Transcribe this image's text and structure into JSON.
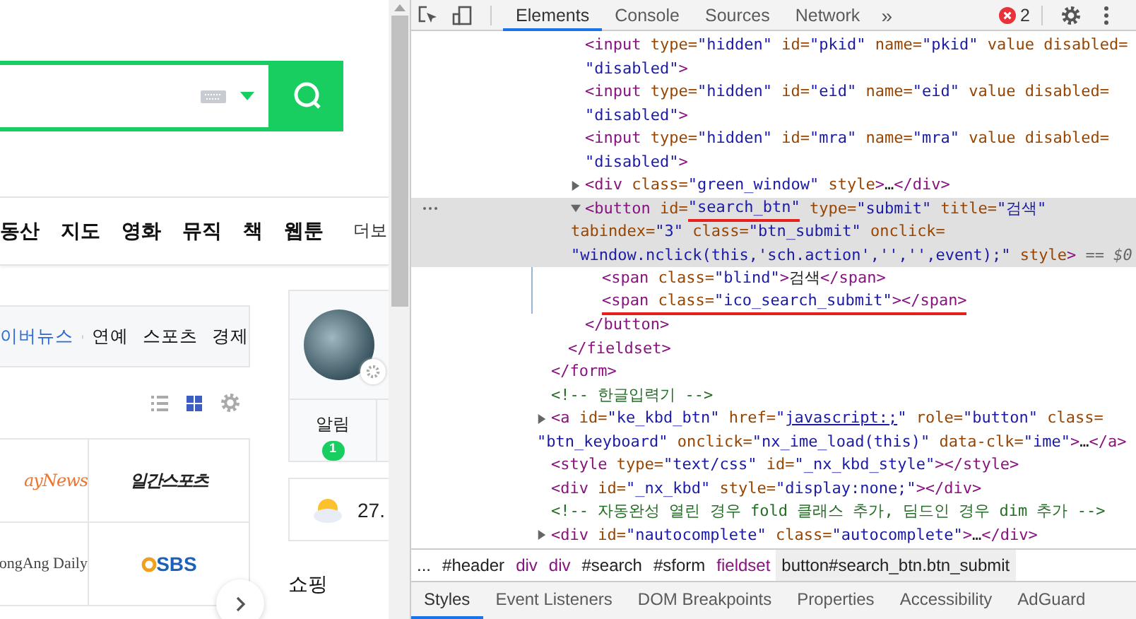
{
  "page": {
    "nav_items": [
      "동산",
      "지도",
      "영화",
      "뮤직",
      "책",
      "웹툰"
    ],
    "nav_more": "더보",
    "news_tabs": [
      {
        "label": "이버뉴스",
        "selected": true
      },
      {
        "label": "연예",
        "selected": false
      },
      {
        "label": "스포츠",
        "selected": false
      },
      {
        "label": "경제",
        "selected": false
      }
    ],
    "view_modes": [
      {
        "kind": "list",
        "selected": false
      },
      {
        "kind": "grid",
        "selected": true
      }
    ],
    "press": [
      {
        "label": "ayNews",
        "kind": "script"
      },
      {
        "label": "일간스포츠",
        "kind": "bold"
      },
      {
        "label": "ongAng Daily",
        "kind": "serif"
      },
      {
        "label": "SBS",
        "kind": "sbs"
      }
    ],
    "notification": {
      "label": "알림",
      "badge": "1"
    },
    "weather": {
      "temp": "27."
    },
    "shopping_title": "쇼핑"
  },
  "devtools": {
    "tabs": [
      {
        "label": "Elements",
        "selected": true
      },
      {
        "label": "Console",
        "selected": false
      },
      {
        "label": "Sources",
        "selected": false
      },
      {
        "label": "Network",
        "selected": false
      }
    ],
    "more_tabs": "»",
    "error_count": "2",
    "tree": [
      {
        "children": [
          {
            "children": [
              {
                "selected": false,
                "lines": [
                  [
                    {
                      "kind": "tag",
                      "text": "<input"
                    },
                    {
                      "kind": "attr",
                      "text": " type="
                    },
                    {
                      "kind": "value",
                      "text": "\"hidden\""
                    },
                    {
                      "kind": "attr",
                      "text": " id="
                    },
                    {
                      "kind": "value",
                      "text": "\"pkid\""
                    },
                    {
                      "kind": "attr",
                      "text": " name="
                    },
                    {
                      "kind": "value",
                      "text": "\"pkid\""
                    },
                    {
                      "kind": "attr",
                      "text": " value disabled="
                    }
                  ],
                  [
                    {
                      "kind": "value",
                      "text": "\"disabled\""
                    },
                    {
                      "kind": "tag",
                      "text": ">"
                    }
                  ]
                ]
              },
              {
                "selected": false,
                "lines": [
                  [
                    {
                      "kind": "tag",
                      "text": "<input"
                    },
                    {
                      "kind": "attr",
                      "text": " type="
                    },
                    {
                      "kind": "value",
                      "text": "\"hidden\""
                    },
                    {
                      "kind": "attr",
                      "text": " id="
                    },
                    {
                      "kind": "value",
                      "text": "\"eid\""
                    },
                    {
                      "kind": "attr",
                      "text": " name="
                    },
                    {
                      "kind": "value",
                      "text": "\"eid\""
                    },
                    {
                      "kind": "attr",
                      "text": " value disabled="
                    }
                  ],
                  [
                    {
                      "kind": "value",
                      "text": "\"disabled\""
                    },
                    {
                      "kind": "tag",
                      "text": ">"
                    }
                  ]
                ]
              },
              {
                "selected": false,
                "lines": [
                  [
                    {
                      "kind": "tag",
                      "text": "<input"
                    },
                    {
                      "kind": "attr",
                      "text": " type="
                    },
                    {
                      "kind": "value",
                      "text": "\"hidden\""
                    },
                    {
                      "kind": "attr",
                      "text": " id="
                    },
                    {
                      "kind": "value",
                      "text": "\"mra\""
                    },
                    {
                      "kind": "attr",
                      "text": " name="
                    },
                    {
                      "kind": "value",
                      "text": "\"mra\""
                    },
                    {
                      "kind": "attr",
                      "text": " value disabled="
                    }
                  ],
                  [
                    {
                      "kind": "value",
                      "text": "\"disabled\""
                    },
                    {
                      "kind": "tag",
                      "text": ">"
                    }
                  ]
                ]
              },
              {
                "selected": false,
                "expanded": false,
                "lines": [
                  [
                    {
                      "kind": "tag",
                      "text": "<div"
                    },
                    {
                      "kind": "attr",
                      "text": " class="
                    },
                    {
                      "kind": "value",
                      "text": "\"green_window\""
                    },
                    {
                      "kind": "attr",
                      "text": " style"
                    },
                    {
                      "kind": "tag",
                      "text": ">"
                    },
                    {
                      "kind": "text",
                      "text": "…"
                    },
                    {
                      "kind": "tag",
                      "text": "</div>"
                    }
                  ]
                ]
              },
              {
                "selected": true,
                "expanded": true,
                "lines": [
                  [
                    {
                      "kind": "tag",
                      "text": "<button"
                    },
                    {
                      "kind": "attr",
                      "text": " id="
                    },
                    {
                      "kind": "value",
                      "text": "\"search_btn\"",
                      "marked": true
                    },
                    {
                      "kind": "attr",
                      "text": " type="
                    },
                    {
                      "kind": "value",
                      "text": "\"submit\""
                    },
                    {
                      "kind": "attr",
                      "text": " title="
                    },
                    {
                      "kind": "value",
                      "text": "\"검색\""
                    }
                  ],
                  [
                    {
                      "kind": "attr",
                      "text": "tabindex="
                    },
                    {
                      "kind": "value",
                      "text": "\"3\""
                    },
                    {
                      "kind": "attr",
                      "text": " class="
                    },
                    {
                      "kind": "value",
                      "text": "\"btn_submit\""
                    },
                    {
                      "kind": "attr",
                      "text": " onclick="
                    }
                  ],
                  [
                    {
                      "kind": "value",
                      "text": "\"window.nclick(this,'sch.action','','',event);\""
                    },
                    {
                      "kind": "attr",
                      "text": " style"
                    },
                    {
                      "kind": "tag",
                      "text": ">"
                    },
                    {
                      "kind": "ref",
                      "text": " == $0"
                    }
                  ]
                ],
                "children": [
                  {
                    "selected": false,
                    "lines": [
                      [
                        {
                          "kind": "tag",
                          "text": "<span"
                        },
                        {
                          "kind": "attr",
                          "text": " class="
                        },
                        {
                          "kind": "value",
                          "text": "\"blind\""
                        },
                        {
                          "kind": "tag",
                          "text": ">"
                        },
                        {
                          "kind": "text",
                          "text": "검색"
                        },
                        {
                          "kind": "tag",
                          "text": "</span>"
                        }
                      ]
                    ]
                  },
                  {
                    "selected": false,
                    "lines": [
                      [
                        {
                          "kind": "tag",
                          "text": "<span",
                          "marked": true
                        },
                        {
                          "kind": "attr",
                          "text": " class=",
                          "marked": true
                        },
                        {
                          "kind": "value",
                          "text": "\"ico_search_submit\"",
                          "marked": true
                        },
                        {
                          "kind": "tag",
                          "text": "></span>",
                          "marked": true
                        }
                      ]
                    ]
                  }
                ],
                "close": "</button>"
              }
            ],
            "close": "</fieldset>"
          }
        ],
        "close": "</form>"
      },
      {
        "selected": false,
        "lines": [
          [
            {
              "kind": "comment",
              "text": "<!-- 한글입력기 -->"
            }
          ]
        ]
      },
      {
        "selected": false,
        "expanded": false,
        "lines": [
          [
            {
              "kind": "tag",
              "text": "<a"
            },
            {
              "kind": "attr",
              "text": " id="
            },
            {
              "kind": "value",
              "text": "\"ke_kbd_btn\""
            },
            {
              "kind": "attr",
              "text": " href="
            },
            {
              "kind": "value",
              "text": "\""
            },
            {
              "kind": "link",
              "text": "javascript:;"
            },
            {
              "kind": "value",
              "text": "\""
            },
            {
              "kind": "attr",
              "text": " role="
            },
            {
              "kind": "value",
              "text": "\"button\""
            },
            {
              "kind": "attr",
              "text": " class="
            }
          ],
          [
            {
              "kind": "value",
              "text": "\"btn_keyboard\""
            },
            {
              "kind": "attr",
              "text": " onclick="
            },
            {
              "kind": "value",
              "text": "\"nx_ime_load(this)\""
            },
            {
              "kind": "attr",
              "text": " data-clk="
            },
            {
              "kind": "value",
              "text": "\"ime\""
            },
            {
              "kind": "tag",
              "text": ">"
            },
            {
              "kind": "text",
              "text": "…"
            },
            {
              "kind": "tag",
              "text": "</a>"
            }
          ]
        ]
      },
      {
        "selected": false,
        "lines": [
          [
            {
              "kind": "tag",
              "text": "<style"
            },
            {
              "kind": "attr",
              "text": " type="
            },
            {
              "kind": "value",
              "text": "\"text/css\""
            },
            {
              "kind": "attr",
              "text": " id="
            },
            {
              "kind": "value",
              "text": "\"_nx_kbd_style\""
            },
            {
              "kind": "tag",
              "text": "></style>"
            }
          ]
        ]
      },
      {
        "selected": false,
        "lines": [
          [
            {
              "kind": "tag",
              "text": "<div"
            },
            {
              "kind": "attr",
              "text": " id="
            },
            {
              "kind": "value",
              "text": "\"_nx_kbd\""
            },
            {
              "kind": "attr",
              "text": " style="
            },
            {
              "kind": "value",
              "text": "\"display:none;\""
            },
            {
              "kind": "tag",
              "text": "></div>"
            }
          ]
        ]
      },
      {
        "selected": false,
        "lines": [
          [
            {
              "kind": "comment",
              "text": "<!-- 자동완성 열린 경우 fold 클래스 추가, 딤드인 경우 dim 추가 -->"
            }
          ]
        ]
      },
      {
        "selected": false,
        "expanded": false,
        "lines": [
          [
            {
              "kind": "tag",
              "text": "<div"
            },
            {
              "kind": "attr",
              "text": " id="
            },
            {
              "kind": "value",
              "text": "\"nautocomplete\""
            },
            {
              "kind": "attr",
              "text": " class="
            },
            {
              "kind": "value",
              "text": "\"autocomplete\""
            },
            {
              "kind": "tag",
              "text": ">"
            },
            {
              "kind": "text",
              "text": "…"
            },
            {
              "kind": "tag",
              "text": "</div>"
            }
          ]
        ]
      }
    ],
    "breadcrumbs": [
      {
        "label": "...",
        "kind": "id",
        "selected": false
      },
      {
        "label": "#header",
        "kind": "id",
        "selected": false
      },
      {
        "label": "div",
        "kind": "tag",
        "selected": false
      },
      {
        "label": "div",
        "kind": "tag",
        "selected": false
      },
      {
        "label": "#search",
        "kind": "id",
        "selected": false
      },
      {
        "label": "#sform",
        "kind": "id",
        "selected": false
      },
      {
        "label": "fieldset",
        "kind": "tag",
        "selected": false
      },
      {
        "label": "button#search_btn.btn_submit",
        "kind": "id",
        "selected": true
      }
    ],
    "panel_tabs": [
      {
        "label": "Styles",
        "selected": true
      },
      {
        "label": "Event Listeners",
        "selected": false
      },
      {
        "label": "DOM Breakpoints",
        "selected": false
      },
      {
        "label": "Properties",
        "selected": false
      },
      {
        "label": "Accessibility",
        "selected": false
      },
      {
        "label": "AdGuard",
        "selected": false
      }
    ]
  }
}
